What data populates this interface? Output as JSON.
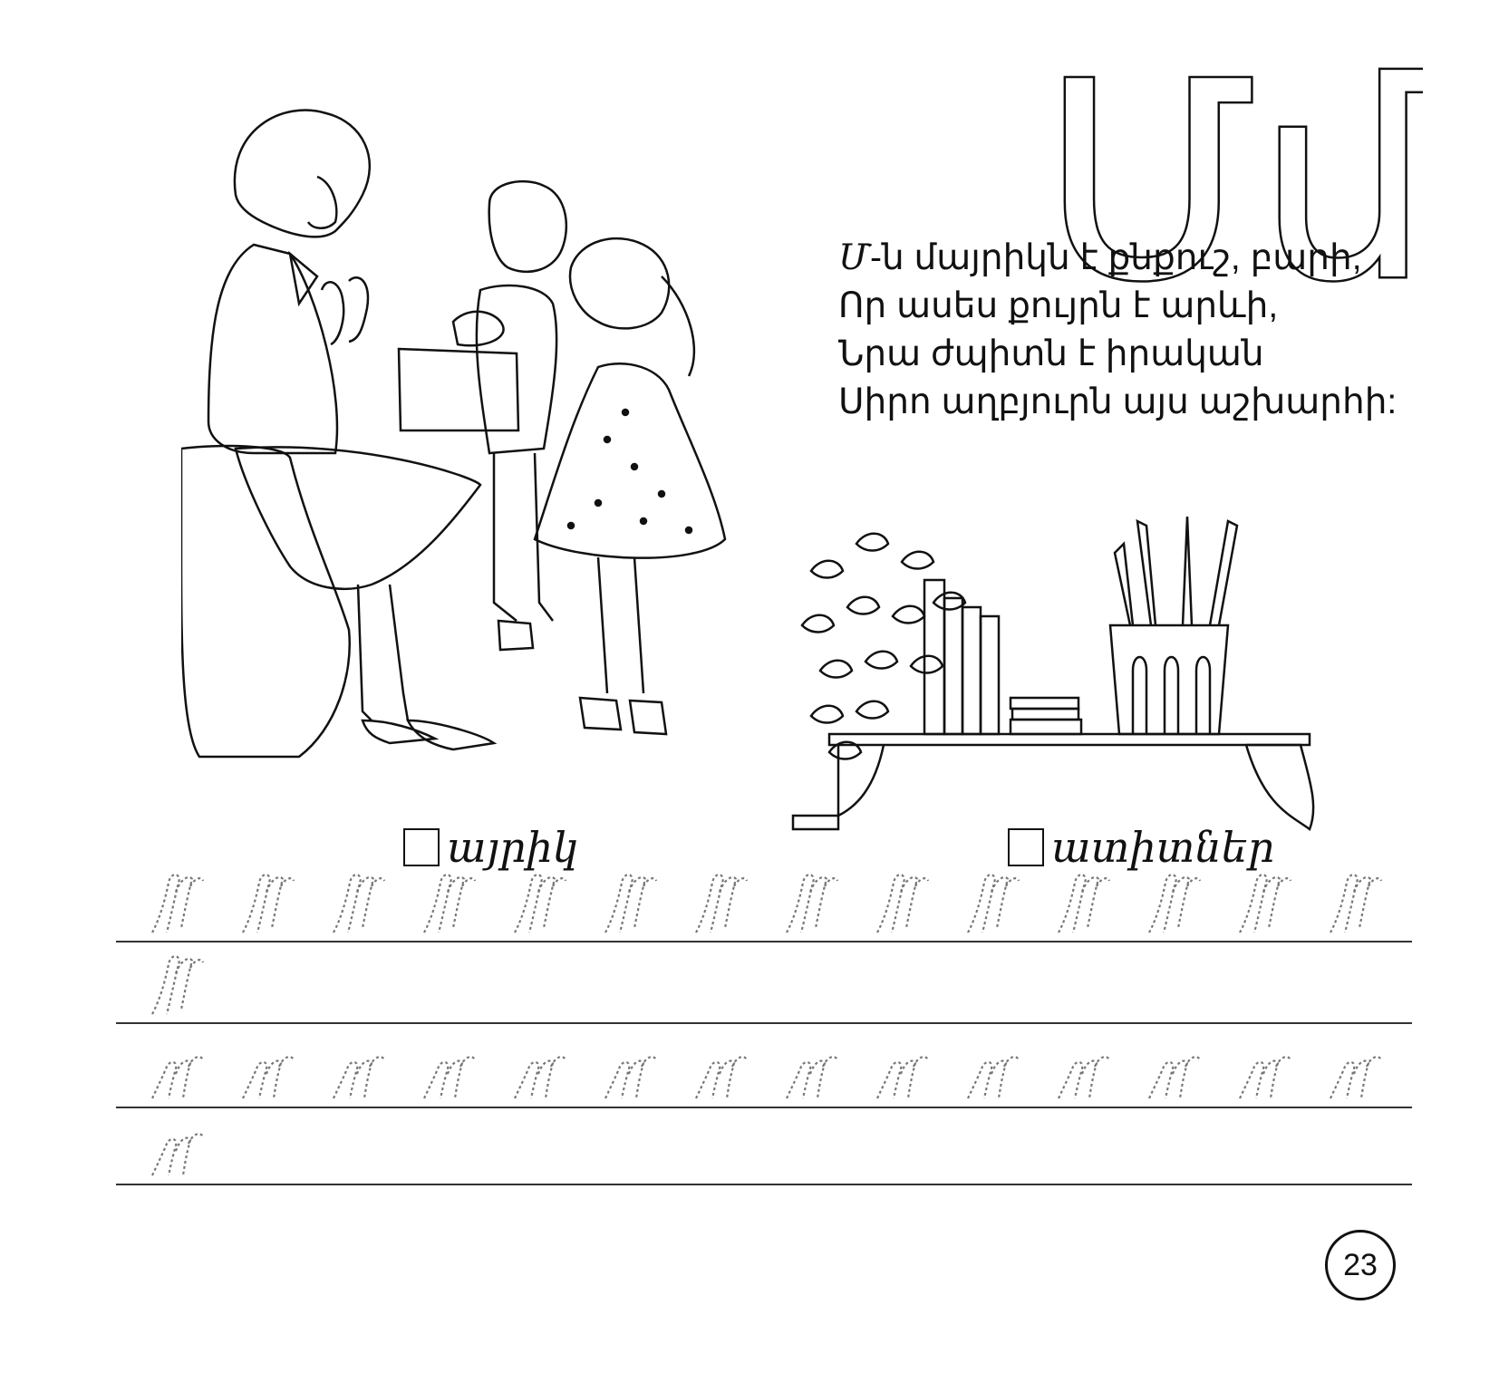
{
  "letter": {
    "display": "Մմ"
  },
  "poem": {
    "first_prefix": "Մ",
    "first_rest": "-ն  մայրիկն է քնքուշ, բարի,",
    "line2": "Որ ասես քույրն է արևի,",
    "line3": "Նրա ժպիտն է իրական",
    "line4": "Սիրո աղբյուրն այս աշխարհի:"
  },
  "captions": {
    "left": "այրիկ",
    "right": "ատիտներ"
  },
  "illustrations": {
    "left": "mother-with-children-drawing",
    "right": "shelf-with-plant-books-pencils-drawing"
  },
  "handwriting": {
    "row1_glyph": "Մ",
    "row1_count": 14,
    "row2_glyph": "Մ",
    "row2_count": 1,
    "row3_glyph": "մ",
    "row3_count": 14,
    "row4_glyph": "մ",
    "row4_count": 1
  },
  "page_number": "23"
}
